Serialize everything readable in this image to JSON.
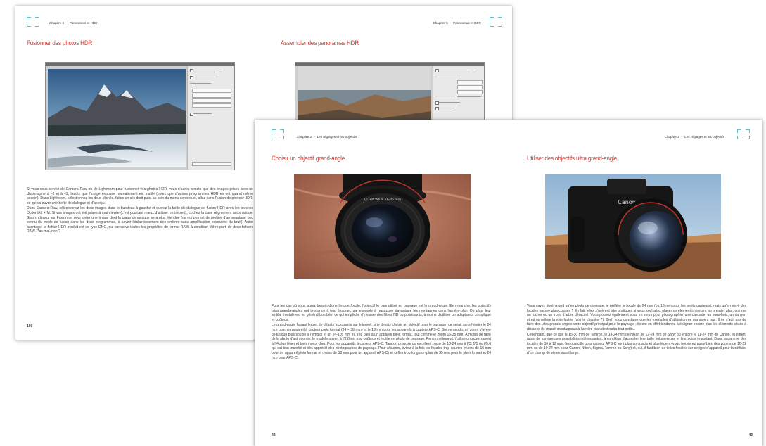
{
  "back_spread": {
    "running_head": {
      "chapter": "Chapitre 5",
      "separator": "-",
      "topic": "Panoramas et HDR"
    },
    "left_page": {
      "title": "Fusionner des photos HDR",
      "paragraphs": [
        "Si vous vous servez de Camera Raw ou de Lightroom pour fusionner vos photos HDR, vous n’aurez besoin que des images prises avec un diaphragme à –2 et à +2, tandis que l’image exposée normalement est inutile (notez que d’autres programmes HDR en ont quand même besoin). Dans Lightroom, sélectionnez les deux clichés, faites un clic droit puis, au sein du menu contextuel, allez dans Fusion de photos>HDR, ce qui va ouvrir une boîte de dialogue et d’aperçu.",
        "Dans Camera Raw, sélectionnez les deux images dans le bandeau à gauche et ouvrez la boîte de dialogue de fusion HDR avec les touches Option/Alt + M. Si vos images ont été prises à main levée (c’est pourtant mieux d’utiliser un trépied), cochez la case Alignement automatique. Sinon, cliquez sur Fusionner pour créer une image dont la plage dynamique sera plus étendue (ce qui permet de profiter d’un avantage peu connu du mode de fusion dans les deux programmes, à savoir l’éclaircissement des ombres sans amplification excessive du bruit). Autre avantage, le fichier HDR produit est de type DNG, qui conserve toutes les propriétés du format RAW, à condition d’être parti de deux fichiers RAW. Pas mal, non ?"
      ],
      "folio": "100"
    },
    "right_page": {
      "title": "Assembler des panoramas HDR"
    }
  },
  "front_spread": {
    "running_head": {
      "chapter": "Chapitre 2",
      "separator": "-",
      "topic": "Les réglages et les objectifs"
    },
    "left_page": {
      "title": "Choisir un objectif grand-angle",
      "lens_text": "ULTRA WIDE 16-35 mm",
      "paragraphs": [
        "Pour les cas où vous aurez besoin d’une longue focale, l’objectif le plus utilisé en paysage est le grand-angle. En revanche, les objectifs ultra grands-angles ont tendance à trop éloigner, par exemple à repousser davantage les montagnes dans l’arrière-plan. De plus, leur lentille frontale est en général bombée, ce qui empêche d’y visser des filtres ND ou polarisants, à moins d’utiliser un adaptateur compliqué et coûteux.",
        "Le grand-angle faisant l’objet de débats incessants sur Internet, si je devais choisir un objectif pour le paysage, ce serait sans hésiter le 24 mm pour un appareil à capteur plein format (24 × 36 mm) et le 18 mm pour les appareils à capteur APS-C. Bien entendu, un zoom s’avère beaucoup plus souple à l’emploi et un 24-105 mm ira très bien à un appareil plein format, tout comme le zoom 16-35 mm. À moins de faire de la photo d’astronomie, le modèle ouvert à f/2,8 est trop coûteux et inutile en photo de paysage. Personnellement, j’utilise un zoom ouvert à f/4 plus léger et bien moins cher. Pour les appareils à capteur APS-C, Tamron propose un excellent zoom de 10-24 mm à f/3, 1/5 ou f/5,6 qui est bon marché et très apprécié des photographes de paysage. Pour résumer, évitez à la fois les focales trop courtes (moins de 16 mm pour un appareil plein format et moins de 18 mm pour un appareil APS-C) et celles trop longues (plus de 35 mm pour le plein format et 24 mm pour APS-C)."
      ],
      "folio": "42"
    },
    "right_page": {
      "title": "Utiliser des objectifs ultra grand-angle",
      "camera_brand": "Canon",
      "paragraphs": [
        "Vous savez dorénavant qu’en photo de paysage, je préfère la focale de 24 mm (ou 18 mm pour les petits capteurs), mais qu’en est-il des focales encore plus courtes ? En fait, elles s’avèrent très pratiques si vous souhaitez placer un élément important au premier plan, comme un rocher ou un tronc d’arbre déraciné. Vous pouvez également vous en servir pour photographier une cascade, un sous-bois, un canyon étroit ou même la voie lactée (voir le chapitre 7). Bref, vous constatez que les exemples d’utilisation ne manquent pas. Il ne s’agit pas de faire des ultra grands-angles votre objectif principal pour le paysage ; ils ont en effet tendance à éloigner encore plus les éléments situés à distance (le massif montagneux à l’arrière-plan deviendra tout petit).",
        "Cependant, que ce soit le 15-30 mm de Tamron, le 14-24 mm de Nikon, le 12-24 mm de Sony ou encore le 11-24 mm de Canon, ils offrent aussi de nombreuses possibilités intéressantes, à condition d’accepter leur taille volumineuse et leur poids important. Dans la gamme des focales de 10 à 12 mm, les objectifs pour capteur APS-C sont plus compacts et plus légers (vous trouverez aussi bien des zooms de 10-22 mm ou de 10-24 mm chez Canon, Nikon, Sigma, Tamron ou Sony) et, oui, il faut bien de telles focales sur ce type d’appareil pour bénéficier d’un champ de vision aussi large."
      ],
      "folio": "43"
    }
  }
}
